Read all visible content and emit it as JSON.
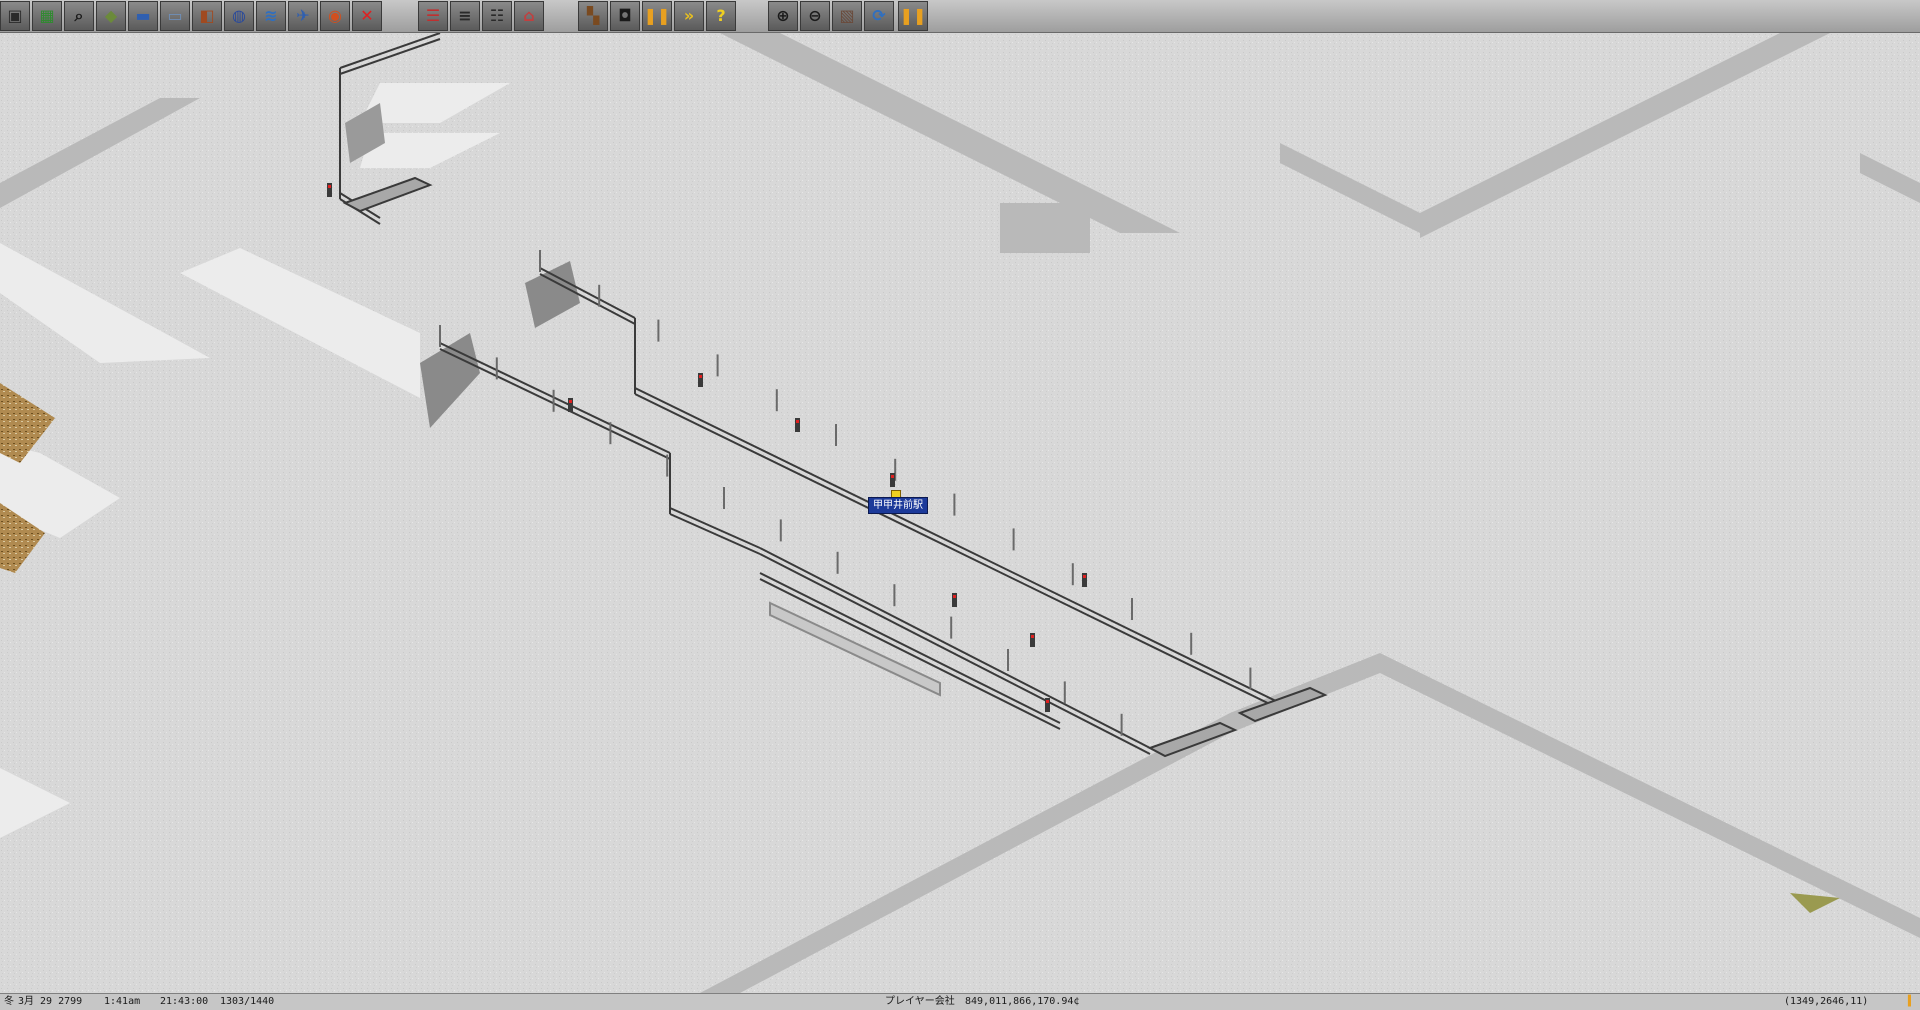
{
  "toolbar": {
    "buttons": [
      {
        "name": "save-icon",
        "glyph": "▣",
        "color": "#2a2a2a"
      },
      {
        "name": "minimap-icon",
        "glyph": "▦",
        "color": "#2e8b2e"
      },
      {
        "name": "inspect-icon",
        "glyph": "⌕",
        "color": "#1a1a1a"
      },
      {
        "name": "terraform-icon",
        "glyph": "◆",
        "color": "#6b8a3a"
      },
      {
        "name": "rail-tools-icon",
        "glyph": "▬",
        "color": "#2f5fb0"
      },
      {
        "name": "monorail-tools-icon",
        "glyph": "▭",
        "color": "#6f8fb8"
      },
      {
        "name": "tram-tools-icon",
        "glyph": "◧",
        "color": "#a04a20"
      },
      {
        "name": "road-tools-icon",
        "glyph": "◍",
        "color": "#2b4a9a"
      },
      {
        "name": "ship-tools-icon",
        "glyph": "≋",
        "color": "#2f6fc0"
      },
      {
        "name": "air-tools-icon",
        "glyph": "✈",
        "color": "#2f5fb0"
      },
      {
        "name": "special-tools-icon",
        "glyph": "◉",
        "color": "#d05020"
      },
      {
        "name": "remove-tool-icon",
        "glyph": "✕",
        "color": "#e02020"
      },
      {
        "name": "line-management-icon",
        "glyph": "☰",
        "color": "#c03030"
      },
      {
        "name": "vehicle-list-icon",
        "glyph": "≡",
        "color": "#2a2a2a"
      },
      {
        "name": "finances-icon",
        "glyph": "☷",
        "color": "#2a2a2a"
      },
      {
        "name": "factory-list-icon",
        "glyph": "⌂",
        "color": "#c04040"
      },
      {
        "name": "depot-icon",
        "glyph": "▚",
        "color": "#7a4a20"
      },
      {
        "name": "screenshot-icon",
        "glyph": "◘",
        "color": "#1a1a1a"
      },
      {
        "name": "pause-icon",
        "glyph": "❚❚",
        "color": "#e8a020"
      },
      {
        "name": "fast-forward-icon",
        "glyph": "»",
        "color": "#e8c020"
      },
      {
        "name": "help-icon",
        "glyph": "?",
        "color": "#f0d020"
      },
      {
        "name": "zoom-in-icon",
        "glyph": "⊕",
        "color": "#1a1a1a"
      },
      {
        "name": "zoom-out-icon",
        "glyph": "⊖",
        "color": "#1a1a1a"
      },
      {
        "name": "grid-toggle-icon",
        "glyph": "▧",
        "color": "#6a4a3a"
      },
      {
        "name": "rotate-view-icon",
        "glyph": "⟳",
        "color": "#2f6fc0"
      },
      {
        "name": "pause-game-icon",
        "glyph": "❚❚",
        "color": "#e8a020"
      }
    ]
  },
  "station_label": "甲甲井前駅",
  "status": {
    "season": "冬",
    "date": "3月 29 2799",
    "time": "1:41am",
    "ticks": "21:43:00",
    "counter": "1303/1440",
    "company": "プレイヤー会社",
    "money": "849,011,866,170.94¢",
    "coords": "(1349,2646,11)"
  },
  "colors": {
    "snow": "#d9d9d9",
    "station_label_bg": "#1c3a9a",
    "rail_dark": "#3a3a3a"
  }
}
